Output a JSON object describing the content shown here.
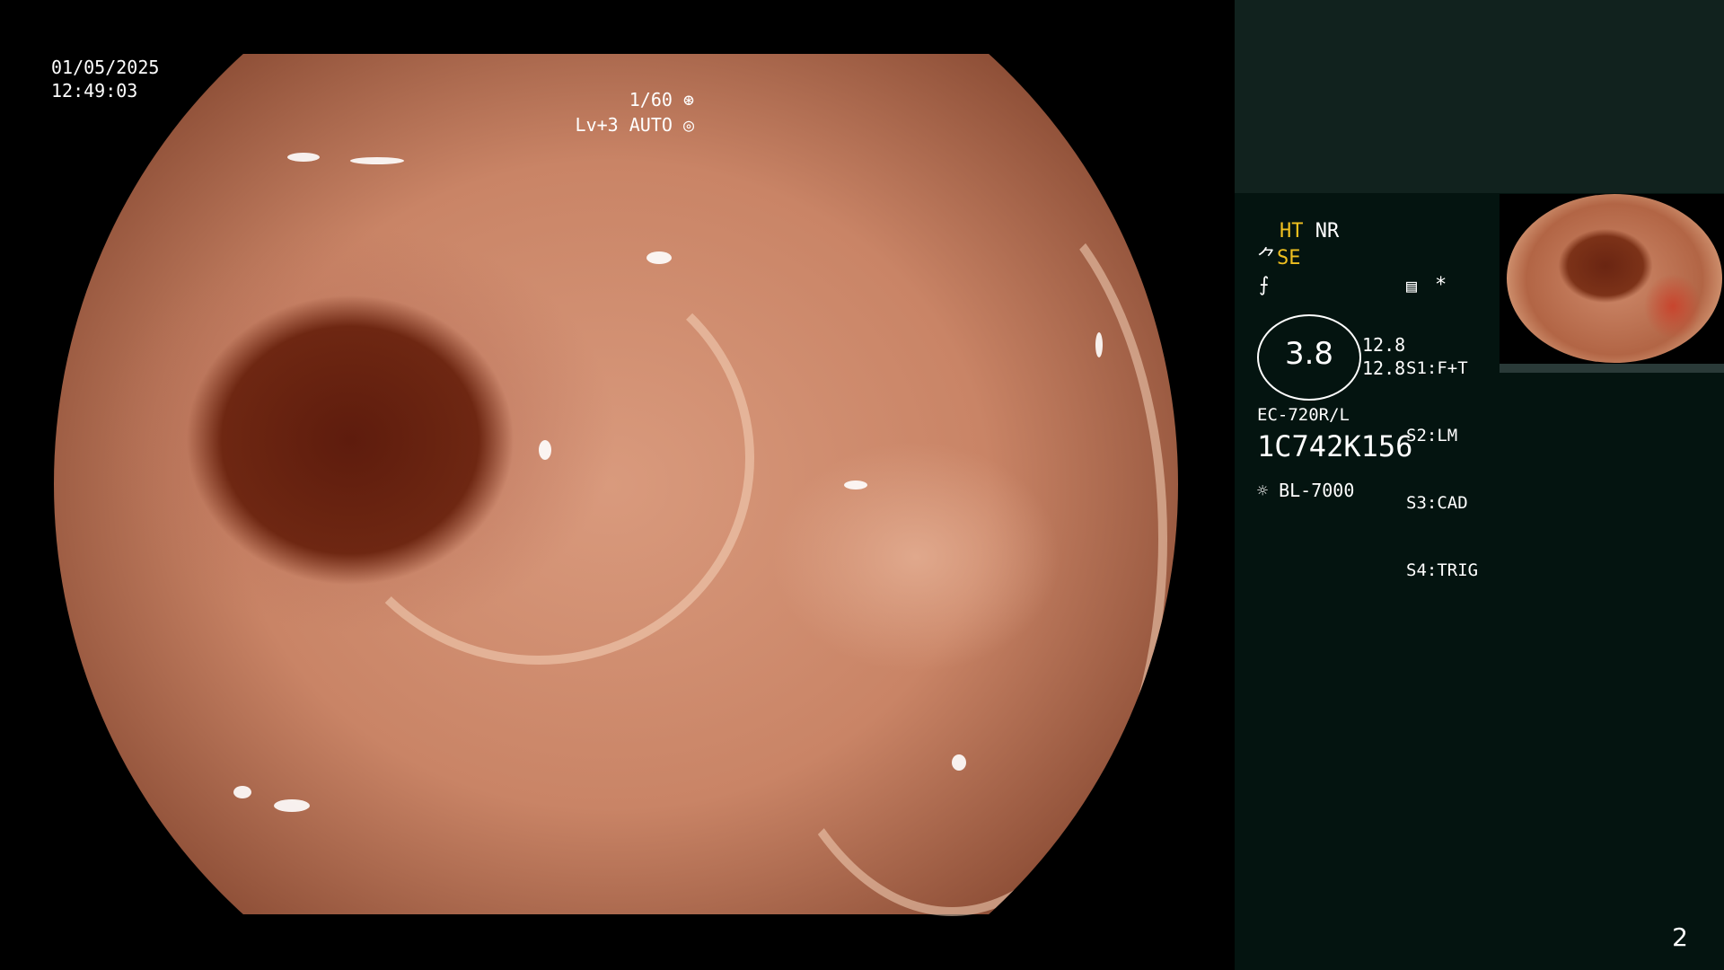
{
  "overlay": {
    "date": "01/05/2025",
    "time": "12:49:03",
    "shutter": "1/60",
    "iris": "Lv+3 AUTO"
  },
  "panel": {
    "ht": "HT",
    "nr": "NR",
    "se": "SE",
    "gauge_value": "3.8",
    "gauge_side_top": "12.8",
    "gauge_side_bottom": "12.8",
    "switches": [
      {
        "key": "S1:",
        "value": "F+T"
      },
      {
        "key": "S2:",
        "value": "LM"
      },
      {
        "key": "S3:",
        "value": "CAD"
      },
      {
        "key": "S4:",
        "value": "TRIG"
      }
    ],
    "scope_model": "EC-720R/L",
    "serial": "1C742K156",
    "light_source": "BL-7000",
    "star": "*"
  },
  "page_number": "2",
  "icons": {
    "shutter": "aperture-icon",
    "iris": "iris-icon",
    "se": "scope-icon",
    "freeze": "freeze-icon",
    "record": "record-icon",
    "light": "light-bulb-icon"
  },
  "colors": {
    "panel_top": "#11221e",
    "panel_bottom": "#041410",
    "highlight": "#f0c020"
  }
}
